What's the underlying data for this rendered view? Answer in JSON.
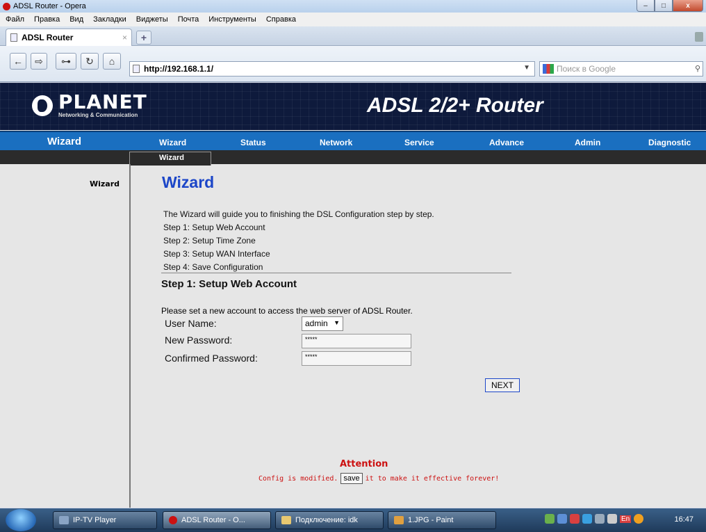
{
  "window": {
    "title": "ADSL Router - Opera",
    "min": "–",
    "max": "□",
    "close": "x"
  },
  "menu": [
    "Файл",
    "Правка",
    "Вид",
    "Закладки",
    "Виджеты",
    "Почта",
    "Инструменты",
    "Справка"
  ],
  "tab": {
    "title": "ADSL Router",
    "close": "×",
    "new_tab": "+"
  },
  "address": {
    "url": "http://192.168.1.1/",
    "search_placeholder": "Поиск в Google"
  },
  "banner": {
    "brand": "PLANET",
    "brand_sub": "Networking & Communication",
    "product": "ADSL 2/2+ Router"
  },
  "nav": {
    "current": "Wizard",
    "items": [
      "Wizard",
      "Status",
      "Network",
      "Service",
      "Advance",
      "Admin",
      "Diagnostic"
    ],
    "subtab": "Wizard"
  },
  "sidebar": {
    "item": "Wizard"
  },
  "content": {
    "title": "Wizard",
    "intro": [
      "The Wizard will guide you to finishing the DSL Configuration step by step.",
      "Step 1: Setup Web Account",
      "Step 2: Setup Time Zone",
      "Step 3: Setup WAN Interface",
      "Step 4: Save Configuration"
    ],
    "section_title": "Step 1: Setup Web Account",
    "description": "Please set a new account to access the web server of ADSL Router.",
    "fields": {
      "user_name_label": "User Name:",
      "user_name_value": "admin",
      "new_password_label": "New Password:",
      "new_password_value": "*****",
      "confirm_password_label": "Confirmed Password:",
      "confirm_password_value": "*****"
    },
    "next_button": "NEXT",
    "attention": "Attention",
    "config_prefix": "Config is modified.",
    "save_button": "save",
    "config_suffix": "it to make it effective forever!"
  },
  "taskbar": {
    "tasks": [
      "IP-TV Player",
      "ADSL Router - O...",
      "Подключение: idk",
      "1.JPG - Paint"
    ],
    "lang": "En",
    "clock": "16:47"
  },
  "colors": {
    "nav_blue": "#1a6fc0",
    "title_blue": "#1c46c8",
    "attention_red": "#cc1111",
    "banner_navy": "#0e1a3c"
  }
}
